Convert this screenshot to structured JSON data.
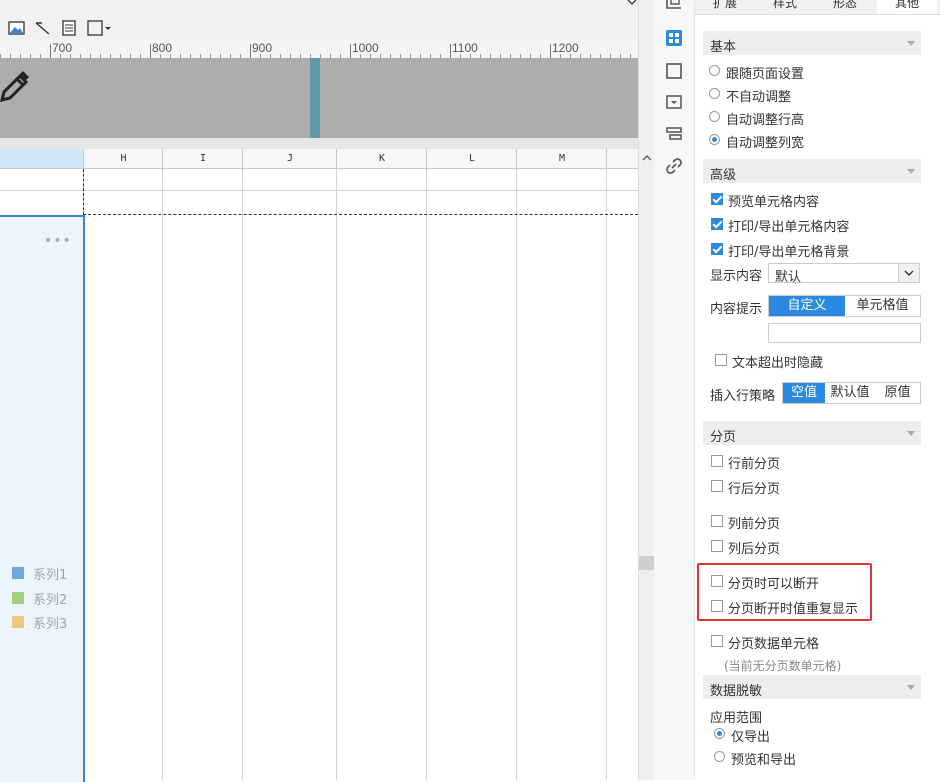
{
  "ruler": {
    "labels": [
      "700",
      "800",
      "900",
      "1000",
      "1100",
      "1200"
    ]
  },
  "columns": [
    "H",
    "I",
    "J",
    "K",
    "L",
    "M"
  ],
  "chart": {
    "more_icon": "•••",
    "legend": [
      {
        "name": "系列1",
        "color": "#6fa8dc"
      },
      {
        "name": "系列2",
        "color": "#a4cf7c"
      },
      {
        "name": "系列3",
        "color": "#f0c77e"
      }
    ]
  },
  "panel": {
    "tabs": [
      "扩展",
      "样式",
      "形态",
      "其他"
    ],
    "basic": {
      "title": "基本",
      "options": [
        "跟随页面设置",
        "不自动调整",
        "自动调整行高",
        "自动调整列宽"
      ],
      "selected": "自动调整列宽"
    },
    "advanced": {
      "title": "高级",
      "checkboxes": [
        "预览单元格内容",
        "打印/导出单元格内容",
        "打印/导出单元格背景"
      ],
      "display_label": "显示内容",
      "display_value": "默认",
      "tooltip_label": "内容提示",
      "tooltip_options": [
        "自定义",
        "单元格值"
      ],
      "tooltip_selected": "自定义",
      "hide_overflow": "文本超出时隐藏",
      "insert_label": "插入行策略",
      "insert_options": [
        "空值",
        "默认值",
        "原值"
      ],
      "insert_selected": "空值"
    },
    "paging": {
      "title": "分页",
      "row_before": "行前分页",
      "row_after": "行后分页",
      "col_before": "列前分页",
      "col_after": "列后分页",
      "can_break": "分页时可以断开",
      "repeat_on_break": "分页断开时值重复显示",
      "data_cell": "分页数据单元格",
      "data_cell_note": "(当前无分页数单元格)"
    },
    "masking": {
      "title": "数据脱敏",
      "scope_label": "应用范围",
      "options": [
        "仅导出",
        "预览和导出"
      ],
      "selected": "仅导出"
    }
  },
  "colors": {
    "accent": "#2a8ae0",
    "highlight": "#e53333",
    "selection": "#3b82e0"
  }
}
